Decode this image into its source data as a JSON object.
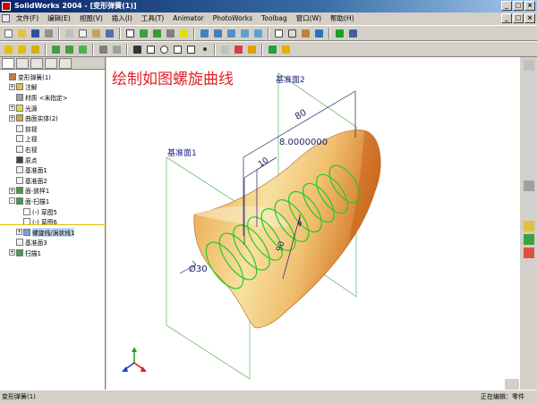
{
  "window": {
    "title": "SolidWorks 2004 - [变形弹簧(1)]",
    "title_buttons": [
      "_",
      "□",
      "×"
    ],
    "mdi_buttons": [
      "_",
      "□",
      "×"
    ]
  },
  "menu": {
    "items": [
      "文件(F)",
      "编辑(E)",
      "视图(V)",
      "插入(I)",
      "工具(T)",
      "Animator",
      "PhotoWorks",
      "Toolbag",
      "窗口(W)",
      "帮助(H)"
    ]
  },
  "feature_tree": {
    "items": [
      {
        "label": "变形弹簧(1)",
        "level": 0,
        "icon": "part-icon",
        "expander": ""
      },
      {
        "label": "注解",
        "level": 1,
        "icon": "annotation-icon",
        "expander": "+"
      },
      {
        "label": "材质 <未指定>",
        "level": 1,
        "icon": "material-icon",
        "expander": ""
      },
      {
        "label": "光源",
        "level": 1,
        "icon": "light-icon",
        "expander": "+"
      },
      {
        "label": "曲面实体(2)",
        "level": 1,
        "icon": "surface-body-icon",
        "expander": "+"
      },
      {
        "label": "前视",
        "level": 1,
        "icon": "plane-icon",
        "expander": ""
      },
      {
        "label": "上视",
        "level": 1,
        "icon": "plane-icon",
        "expander": ""
      },
      {
        "label": "右视",
        "level": 1,
        "icon": "plane-icon",
        "expander": ""
      },
      {
        "label": "原点",
        "level": 1,
        "icon": "origin-icon",
        "expander": ""
      },
      {
        "label": "基准面1",
        "level": 1,
        "icon": "plane-icon",
        "expander": ""
      },
      {
        "label": "基准面2",
        "level": 1,
        "icon": "plane-icon",
        "expander": ""
      },
      {
        "label": "面-放样1",
        "level": 1,
        "icon": "loft-icon",
        "expander": "+"
      },
      {
        "label": "面-扫描1",
        "level": 1,
        "icon": "sweep-icon",
        "expander": "-"
      },
      {
        "label": "(-) 草图5",
        "level": 2,
        "icon": "sketch-icon",
        "expander": ""
      },
      {
        "label": "(-) 草图6",
        "level": 2,
        "icon": "sketch-icon",
        "expander": ""
      },
      {
        "label": "螺旋线/涡状线1",
        "level": 2,
        "icon": "helix-icon",
        "expander": "+",
        "selected": true
      },
      {
        "label": "基准面3",
        "level": 1,
        "icon": "plane-icon",
        "expander": ""
      },
      {
        "label": "扫描1",
        "level": 1,
        "icon": "sweep-icon",
        "expander": "+"
      }
    ]
  },
  "viewport": {
    "caption": "绘制如图螺旋曲线",
    "caption_color": "#e0202a",
    "plane1_label": "基准面1",
    "plane2_label": "基准面2",
    "dim_80": "80",
    "dim_8": "8.0000000",
    "dim_10": "10",
    "dim_90": "90",
    "dim_d30": "Ø30",
    "plane_color": "#6cc070",
    "helix_color": "#22cc22",
    "dim_color": "#202060"
  },
  "status": {
    "left": "变形弹簧(1)",
    "right": "正在编辑：零件"
  }
}
